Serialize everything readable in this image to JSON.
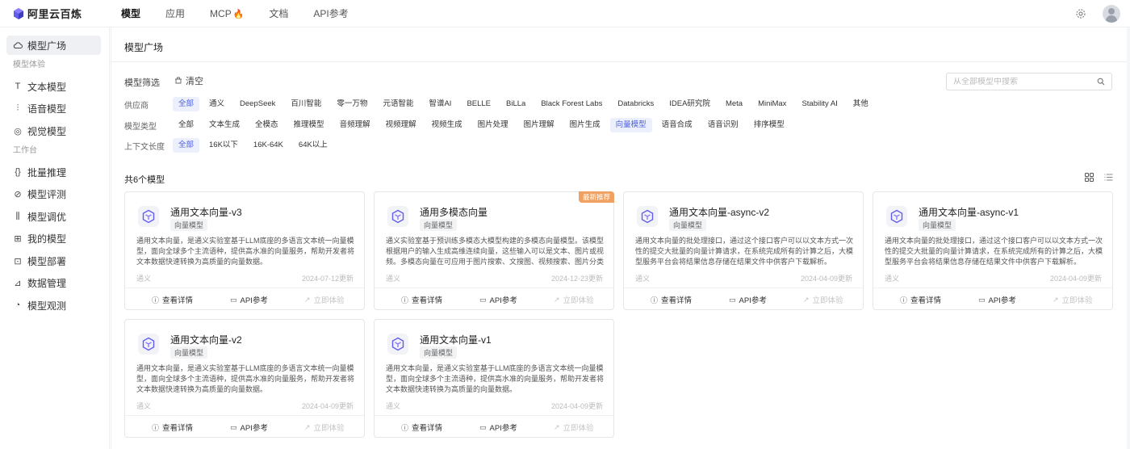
{
  "app": {
    "name": "阿里云百炼"
  },
  "nav": [
    {
      "label": "模型",
      "active": true
    },
    {
      "label": "应用",
      "active": false
    },
    {
      "label": "MCP",
      "active": false,
      "flame": "🔥"
    },
    {
      "label": "文档",
      "active": false
    },
    {
      "label": "API参考",
      "active": false
    }
  ],
  "sidebar": {
    "top": {
      "label": "模型广场",
      "icon": "cloud-icon"
    },
    "group1": "模型体验",
    "experience": [
      {
        "label": "文本模型",
        "icon": "text-icon",
        "glyph": "T"
      },
      {
        "label": "语音模型",
        "icon": "waveform-icon",
        "glyph": "⫶"
      },
      {
        "label": "视觉模型",
        "icon": "camera-icon",
        "glyph": "◎"
      }
    ],
    "group2": "工作台",
    "workbench": [
      {
        "label": "批量推理",
        "icon": "batch-icon",
        "glyph": "{}"
      },
      {
        "label": "模型评测",
        "icon": "compass-icon",
        "glyph": "⊘"
      },
      {
        "label": "模型调优",
        "icon": "sliders-icon",
        "glyph": "⫼"
      },
      {
        "label": "我的模型",
        "icon": "apps-icon",
        "glyph": "⊞"
      },
      {
        "label": "模型部署",
        "icon": "deploy-icon",
        "glyph": "⊡"
      },
      {
        "label": "数据管理",
        "icon": "chart-icon",
        "glyph": "⊿"
      },
      {
        "label": "模型观测",
        "icon": "pie-icon",
        "glyph": "◔"
      }
    ]
  },
  "main": {
    "title": "模型广场",
    "filter_title": "模型筛选",
    "clear": "清空",
    "search_placeholder": "从全部模型中搜索",
    "filters": [
      {
        "label": "供应商",
        "options": [
          "全部",
          "通义",
          "DeepSeek",
          "百川智能",
          "零一万物",
          "元语智能",
          "智谱AI",
          "BELLE",
          "BiLLa",
          "Black Forest Labs",
          "Databricks",
          "IDEA研究院",
          "Meta",
          "MiniMax",
          "Stability AI",
          "其他"
        ],
        "active": 0
      },
      {
        "label": "模型类型",
        "options": [
          "全部",
          "文本生成",
          "全模态",
          "推理模型",
          "音频理解",
          "视频理解",
          "视频生成",
          "图片处理",
          "图片理解",
          "图片生成",
          "向量模型",
          "语音合成",
          "语音识别",
          "排序模型"
        ],
        "active": 10
      },
      {
        "label": "上下文长度",
        "options": [
          "全部",
          "16K以下",
          "16K-64K",
          "64K以上"
        ],
        "active": 0
      }
    ],
    "count": "共6个模型",
    "actions": {
      "detail": "查看详情",
      "api": "API参考",
      "try": "立即体验"
    },
    "cards": [
      {
        "name": "通用文本向量-v3",
        "tag": "向量模型",
        "desc": "通用文本向量，是通义实验室基于LLM底座的多语言文本统一向量模型，面向全球多个主流语种，提供高水准的向量服务，帮助开发者将文本数据快速转换为高质量的向量数据。",
        "provider": "通义",
        "date": "2024-07-12更新",
        "badge": ""
      },
      {
        "name": "通用多模态向量",
        "tag": "向量模型",
        "desc": "通义实验室基于预训练多模态大模型构建的多模态向量模型。该模型根据用户的输入生成高维连续向量，这些输入可以是文本、图片或视频。多模态向量在可应用于图片搜索、文搜图、视频搜索、图片分类和视频内容审核等下游任务。",
        "provider": "通义",
        "date": "2024-12-23更新",
        "badge": "最新推荐"
      },
      {
        "name": "通用文本向量-async-v2",
        "tag": "向量模型",
        "desc": "通用文本向量的批处理接口，通过这个接口客户可以以文本方式一次性的提交大批量的向量计算请求，在系统完成所有的计算之后，大模型服务平台会将结果信息存储在结果文件中供客户下载解析。",
        "provider": "通义",
        "date": "2024-04-09更新",
        "badge": ""
      },
      {
        "name": "通用文本向量-async-v1",
        "tag": "向量模型",
        "desc": "通用文本向量的批处理接口，通过这个接口客户可以以文本方式一次性的提交大批量的向量计算请求，在系统完成所有的计算之后，大模型服务平台会将结果信息存储在结果文件中供客户下载解析。",
        "provider": "通义",
        "date": "2024-04-09更新",
        "badge": ""
      },
      {
        "name": "通用文本向量-v2",
        "tag": "向量模型",
        "desc": "通用文本向量，是通义实验室基于LLM底座的多语言文本统一向量模型，面向全球多个主流语种，提供高水准的向量服务，帮助开发者将文本数据快速转换为高质量的向量数据。",
        "provider": "通义",
        "date": "2024-04-09更新",
        "badge": ""
      },
      {
        "name": "通用文本向量-v1",
        "tag": "向量模型",
        "desc": "通用文本向量，是通义实验室基于LLM底座的多语言文本统一向量模型，面向全球多个主流语种，提供高水准的向量服务，帮助开发者将文本数据快速转换为高质量的向量数据。",
        "provider": "通义",
        "date": "2024-04-09更新",
        "badge": ""
      }
    ]
  },
  "colors": {
    "accent": "#4b5fe0",
    "accent_bg": "#eceffc",
    "badge": "#f0a060",
    "logo": "#615ced"
  }
}
